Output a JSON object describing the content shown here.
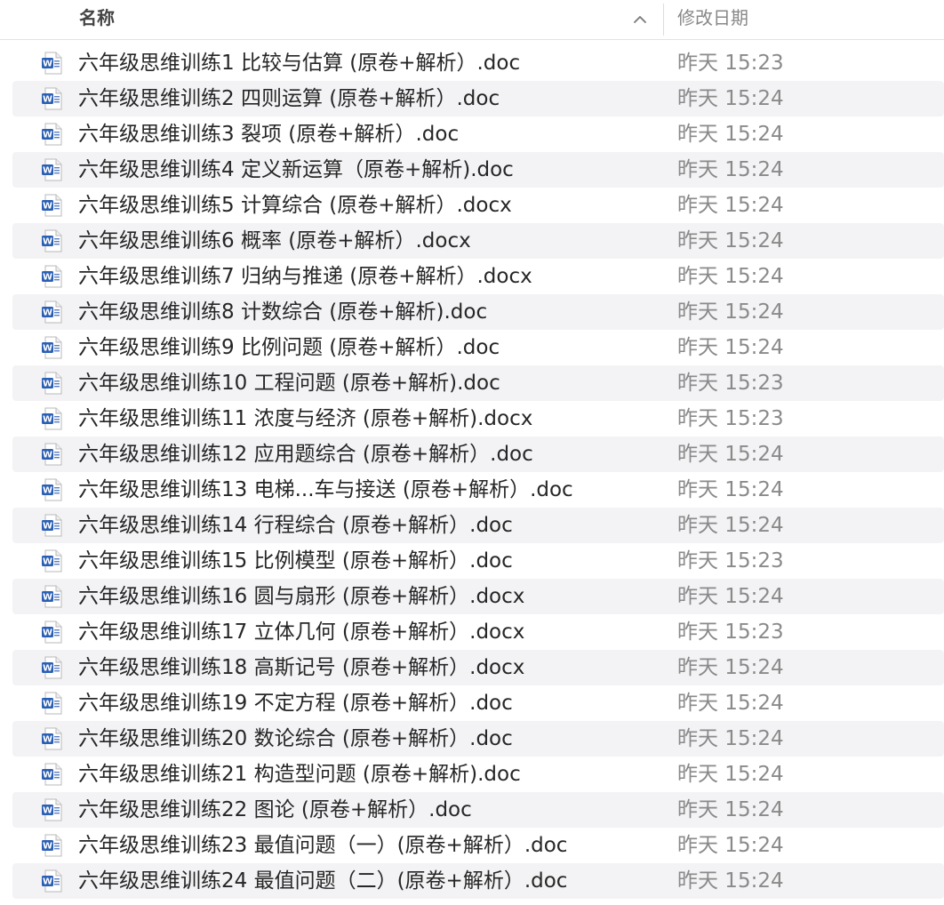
{
  "header": {
    "name_label": "名称",
    "date_label": "修改日期",
    "sort_icon": "chevron-up-icon"
  },
  "accent": {
    "word_blue": "#2b5fb4",
    "row_alt": "#f3f3f5"
  },
  "files": [
    {
      "name": "六年级思维训练1  比较与估算 (原卷+解析）.doc",
      "date": "昨天 15:23",
      "icon": "doc-file-icon"
    },
    {
      "name": "六年级思维训练2  四则运算 (原卷+解析）.doc",
      "date": "昨天 15:24",
      "icon": "doc-file-icon"
    },
    {
      "name": "六年级思维训练3  裂项 (原卷+解析）.doc",
      "date": "昨天 15:24",
      "icon": "doc-file-icon"
    },
    {
      "name": "六年级思维训练4  定义新运算（原卷+解析).doc",
      "date": "昨天 15:24",
      "icon": "doc-file-icon"
    },
    {
      "name": "六年级思维训练5  计算综合 (原卷+解析）.docx",
      "date": "昨天 15:24",
      "icon": "docx-file-icon"
    },
    {
      "name": "六年级思维训练6  概率 (原卷+解析）.docx",
      "date": "昨天 15:24",
      "icon": "docx-file-icon"
    },
    {
      "name": "六年级思维训练7  归纳与推递 (原卷+解析）.docx",
      "date": "昨天 15:24",
      "icon": "docx-file-icon"
    },
    {
      "name": "六年级思维训练8  计数综合 (原卷+解析).doc",
      "date": "昨天 15:24",
      "icon": "doc-file-icon"
    },
    {
      "name": "六年级思维训练9  比例问题 (原卷+解析）.doc",
      "date": "昨天 15:24",
      "icon": "doc-file-icon"
    },
    {
      "name": "六年级思维训练10  工程问题 (原卷+解析).doc",
      "date": "昨天 15:23",
      "icon": "doc-file-icon"
    },
    {
      "name": "六年级思维训练11  浓度与经济 (原卷+解析).docx",
      "date": "昨天 15:23",
      "icon": "docx-file-icon"
    },
    {
      "name": "六年级思维训练12  应用题综合 (原卷+解析）.doc",
      "date": "昨天 15:24",
      "icon": "doc-file-icon"
    },
    {
      "name": "六年级思维训练13  电梯...车与接送 (原卷+解析）.doc",
      "date": "昨天 15:24",
      "icon": "doc-file-icon"
    },
    {
      "name": "六年级思维训练14  行程综合 (原卷+解析）.doc",
      "date": "昨天 15:24",
      "icon": "doc-file-icon"
    },
    {
      "name": "六年级思维训练15  比例模型 (原卷+解析）.doc",
      "date": "昨天 15:23",
      "icon": "doc-file-icon"
    },
    {
      "name": "六年级思维训练16  圆与扇形 (原卷+解析）.docx",
      "date": "昨天 15:24",
      "icon": "docx-file-icon"
    },
    {
      "name": "六年级思维训练17  立体几何 (原卷+解析）.docx",
      "date": "昨天 15:23",
      "icon": "docx-file-icon"
    },
    {
      "name": "六年级思维训练18  高斯记号 (原卷+解析）.docx",
      "date": "昨天 15:24",
      "icon": "docx-file-icon"
    },
    {
      "name": "六年级思维训练19  不定方程 (原卷+解析）.doc",
      "date": "昨天 15:24",
      "icon": "doc-file-icon"
    },
    {
      "name": "六年级思维训练20  数论综合 (原卷+解析）.doc",
      "date": "昨天 15:24",
      "icon": "doc-file-icon"
    },
    {
      "name": "六年级思维训练21  构造型问题 (原卷+解析).doc",
      "date": "昨天 15:24",
      "icon": "doc-file-icon"
    },
    {
      "name": "六年级思维训练22  图论 (原卷+解析）.doc",
      "date": "昨天 15:24",
      "icon": "doc-file-icon"
    },
    {
      "name": "六年级思维训练23  最值问题（一）(原卷+解析）.doc",
      "date": "昨天 15:24",
      "icon": "doc-file-icon"
    },
    {
      "name": "六年级思维训练24  最值问题（二）(原卷+解析）.doc",
      "date": "昨天 15:24",
      "icon": "doc-file-icon"
    }
  ]
}
